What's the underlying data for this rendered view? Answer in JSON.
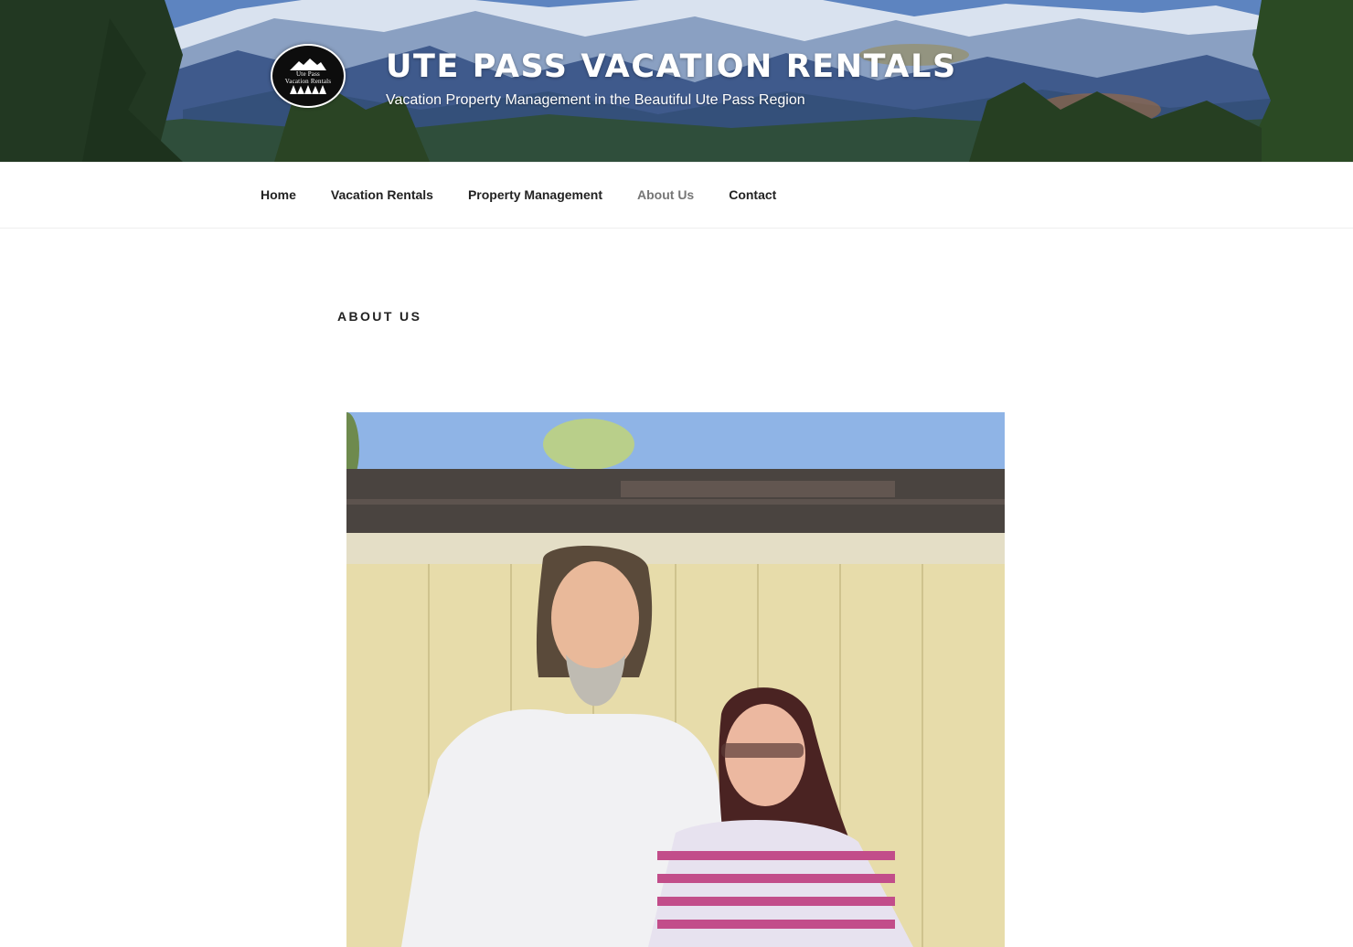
{
  "header": {
    "title": "Ute Pass Vacation Rentals",
    "description": "Vacation Property Management in the Beautiful Ute Pass Region",
    "logo_text": [
      "Ute Pass",
      "Vacation Rentals"
    ]
  },
  "nav": {
    "items": [
      {
        "label": "Home"
      },
      {
        "label": "Vacation Rentals"
      },
      {
        "label": "Property Management"
      },
      {
        "label": "About Us",
        "current": true
      },
      {
        "label": "Contact"
      }
    ]
  },
  "page": {
    "title": "About Us"
  },
  "colors": {
    "text": "#222222",
    "nav_current": "#767676",
    "header_text": "#ffffff"
  }
}
